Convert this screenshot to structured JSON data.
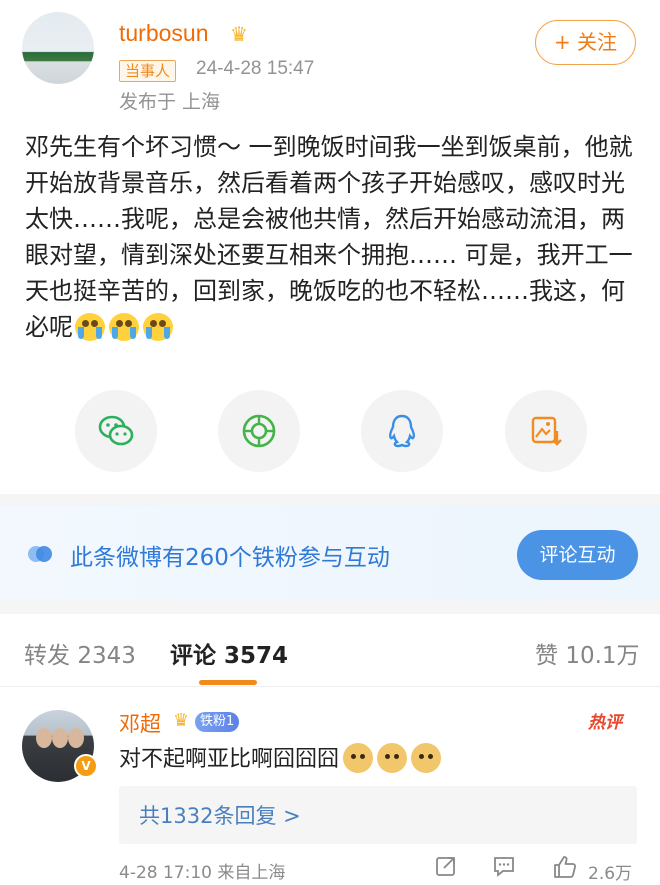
{
  "post": {
    "username": "turbosun",
    "tag": "当事人",
    "timestamp": "24-4-28 15:47",
    "location": "发布于 上海",
    "follow_label": "+ 关注",
    "content": "邓先生有个坏习惯～ 一到晚饭时间我一坐到饭桌前，他就开始放背景音乐，然后看着两个孩子开始感叹，感叹时光太快……我呢，总是会被他共情，然后开始感动流泪，两眼对望，情到深处还要互相来个拥抱…… 可是，我开工一天也挺辛苦的，回到家，晚饭吃的也不轻松……我这，何必呢",
    "emoji_icons": [
      "crying-face-icon",
      "crying-face-icon",
      "crying-face-icon"
    ],
    "share_buttons": [
      "wechat-icon",
      "moments-icon",
      "qq-icon",
      "save-image-icon"
    ]
  },
  "fans_bar": {
    "text": "此条微博有260个铁粉参与互动",
    "button_label": "评论互动"
  },
  "tabs": {
    "repost_label": "转发",
    "repost_count": "2343",
    "comment_label": "评论",
    "comment_count": "3574",
    "like_label": "赞",
    "like_count": "10.1万",
    "accent": "#f18a1d"
  },
  "comment": {
    "name": "邓超",
    "fan_badge": "铁粉1",
    "hot_badge": "热评",
    "text": "对不起啊亚比啊囧囧囧",
    "emoji_icons": [
      "doge-icon",
      "doge-icon",
      "doge-icon"
    ],
    "replies_label": "共1332条回复 >",
    "time": "4-28 17:10",
    "source": "来自上海",
    "like_count": "2.6万"
  },
  "colors": {
    "username": "#f06b05",
    "link_blue": "#2f7ad7",
    "button_blue": "#4a93e5"
  }
}
